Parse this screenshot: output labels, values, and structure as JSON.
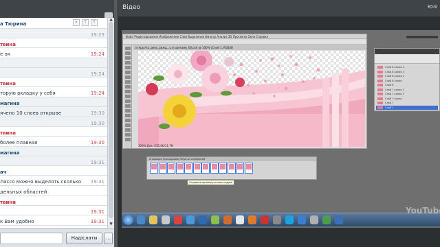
{
  "chat": {
    "messages": [
      {
        "kind": "toolbar-name",
        "text": "а Тюрина",
        "style": "blue",
        "tools": [
          "x",
          "T",
          "T"
        ]
      },
      {
        "kind": "time-only",
        "text": "",
        "time": "19:23",
        "shade": true
      },
      {
        "kind": "name",
        "text": "твина",
        "style": "red"
      },
      {
        "kind": "text",
        "text": "е ок",
        "time": "19:24",
        "time_red": true
      },
      {
        "kind": "name",
        "text": "",
        "style": "blue",
        "shade": true
      },
      {
        "kind": "time-only",
        "text": "",
        "time": "19:24",
        "shade": true
      },
      {
        "kind": "name",
        "text": "твина",
        "style": "red"
      },
      {
        "kind": "text",
        "text": "торую вкладку у себя",
        "time": "19:24",
        "time_red": true
      },
      {
        "kind": "name",
        "text": "магина",
        "style": "blue",
        "shade": true
      },
      {
        "kind": "text",
        "text": "ячено 10 слоев  открыве",
        "time": "19:30",
        "shade": true
      },
      {
        "kind": "time-only",
        "text": "",
        "time": "19:30",
        "shade": true
      },
      {
        "kind": "name",
        "text": "твина",
        "style": "red"
      },
      {
        "kind": "text",
        "text": "более плавная",
        "time": "19:30",
        "time_red": true
      },
      {
        "kind": "name",
        "text": "магина",
        "style": "blue",
        "shade": true
      },
      {
        "kind": "time-only",
        "text": "",
        "time": "19:31",
        "shade": true
      },
      {
        "kind": "name",
        "text": "ач",
        "style": "blue"
      },
      {
        "kind": "text",
        "text": "Лассо можно выделять сколько",
        "time": "19:31"
      },
      {
        "kind": "text",
        "text": "дельных областей",
        "time": ""
      },
      {
        "kind": "name",
        "text": "твина",
        "style": "red"
      },
      {
        "kind": "time-only",
        "text": "",
        "time": "19:31",
        "time_red": true
      },
      {
        "kind": "text",
        "text": "к Вам удобно",
        "time": "19:31",
        "time_red": true
      }
    ],
    "input_value": "",
    "send_label": "Надіслати",
    "extra_label": "…"
  },
  "video": {
    "title": "Відео",
    "user": "Юлі"
  },
  "screen": {
    "ps_menubar": "Файл  Редактирование  Изображение  Слои  Выделение  Фильтр  Анализ  3D  Просмотр  Окно  Справка",
    "ps_tab": "открытка_день_рожд...ь и цветами_00.psd @ 100% (Слой 1, RGB/8)",
    "ps_status": "100%     Док: 615,6K/11,7M",
    "layers": [
      "Слой 8 копия 4",
      "Слой 8 копия 3",
      "Слой 8 копия 2",
      "Слой 8 копия",
      "Слой 8",
      "Слой 7 копия 3",
      "Слой 7 копия 2",
      "Слой 7 копия",
      "Слой 7",
      "Слой 1"
    ],
    "layers_selected_index": 9,
    "anim_tabs": "Анимация (покадровая)     Журнал измерений",
    "frames": [
      "0 сек.",
      "0 сек.",
      "0 сек.",
      "0 сек.",
      "0 сек.",
      "0 сек.",
      "0 сек.",
      "0 сек.",
      "0 сек.",
      "0 сек.",
      "0 сек.",
      "0 сек."
    ],
    "tooltip": "Создание промежуточных кадров",
    "tray_time": "",
    "watermark": "YouTube"
  }
}
